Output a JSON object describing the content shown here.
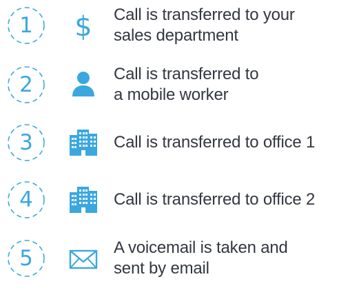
{
  "colors": {
    "accent": "#3aa8de",
    "text": "#333740"
  },
  "steps": [
    {
      "number": "1",
      "icon": "dollar-icon",
      "lines": [
        "Call is transferred to your",
        "sales department"
      ]
    },
    {
      "number": "2",
      "icon": "person-icon",
      "lines": [
        "Call is transferred to",
        "a mobile worker"
      ]
    },
    {
      "number": "3",
      "icon": "building-icon",
      "lines": [
        "Call is transferred to office 1"
      ]
    },
    {
      "number": "4",
      "icon": "building-icon",
      "lines": [
        "Call is transferred to office 2"
      ]
    },
    {
      "number": "5",
      "icon": "envelope-icon",
      "lines": [
        "A voicemail is taken and",
        "sent by email"
      ]
    }
  ]
}
